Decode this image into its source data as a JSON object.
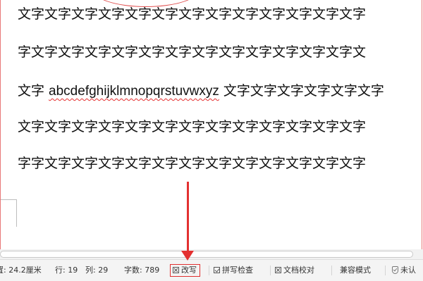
{
  "document": {
    "lines": [
      "文字文字文字文字文字文字文字文字文字文字文字文字文字",
      "字文字文字文字文字文字文字文字文字文字文字文字文字文",
      {
        "before": "文字 ",
        "latin": "abcdefghijklmnopqrstuvwxyz",
        "after": " 文字文字文字文字文字文字"
      },
      "文字文字文字文字文字文字文字文字文字文字文字文字文字",
      "字字文字文字文字文字文字文字文字文字文字文字文字文字"
    ]
  },
  "status_bar": {
    "page_position": "置: 24.2厘米",
    "line": "行: 19",
    "column": "列: 29",
    "word_count": "字数: 789",
    "revise_label": "改写",
    "spell_check_label": "拼写检查",
    "proofread_label": "文档校对",
    "compat_mode_label": "兼容模式",
    "unauthenticated_label": "未认"
  },
  "annotation": {
    "color": "#e33030"
  }
}
